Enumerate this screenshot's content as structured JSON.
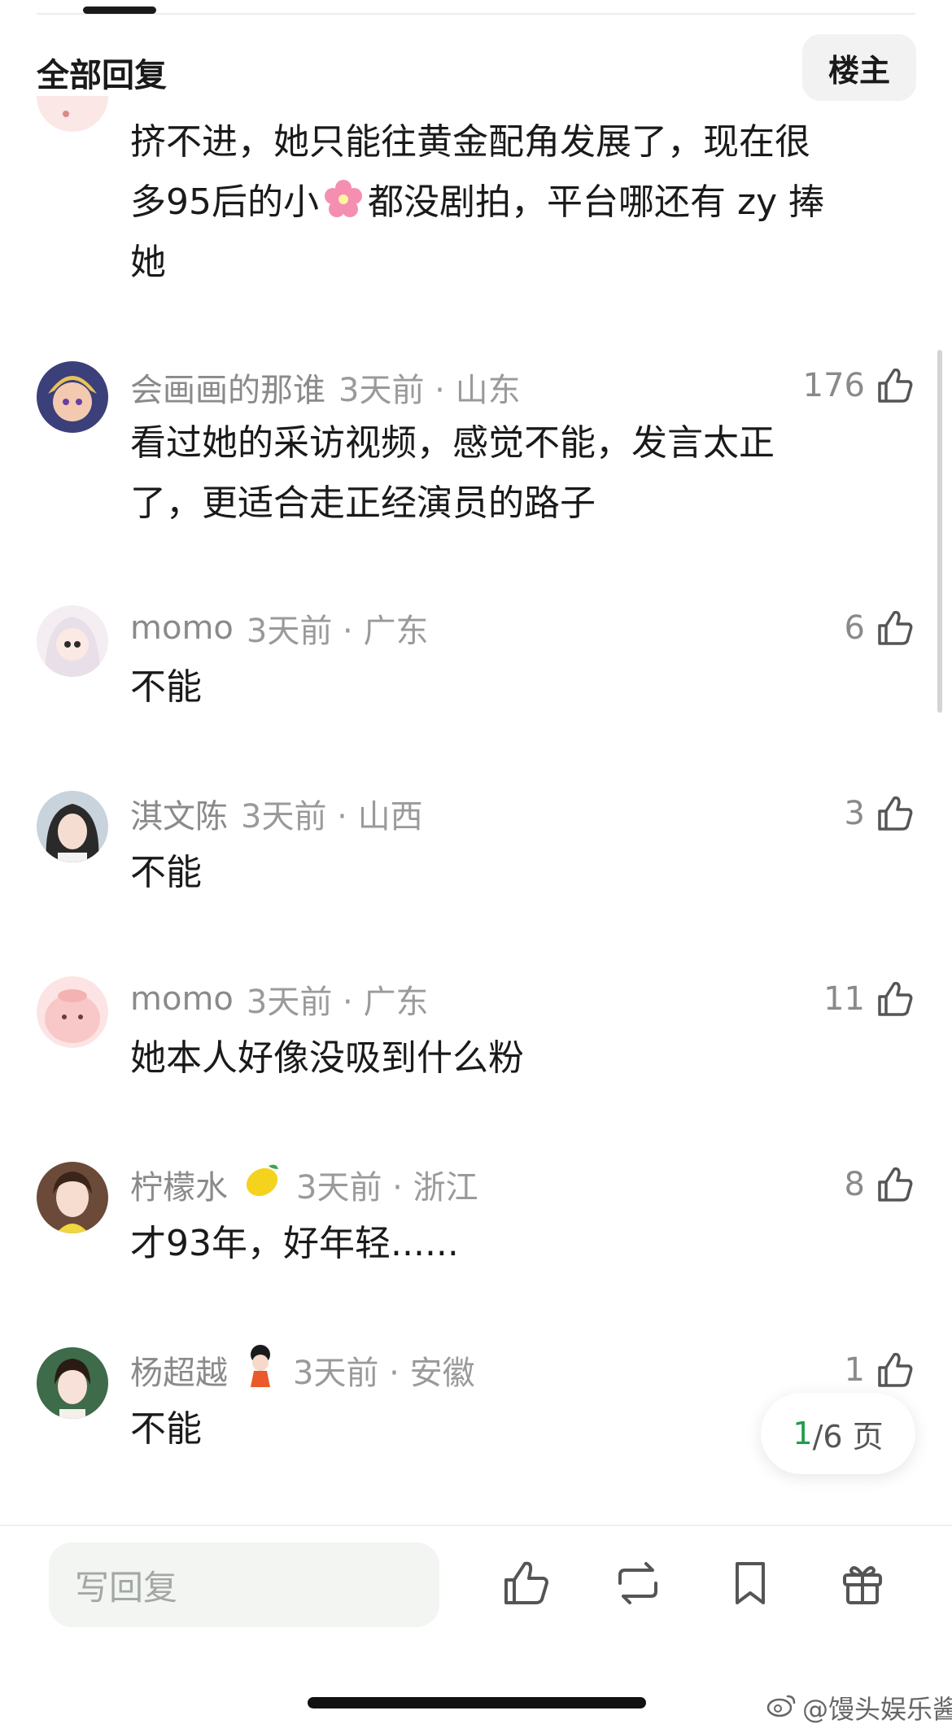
{
  "header": {
    "title": "全部回复",
    "louzhu_label": "楼主"
  },
  "continued_comment": {
    "line1": "挤不进，她只能往黄金配角发展了，现在很",
    "line2_before": "多95后的小",
    "line2_emoji": "cherry-blossom",
    "line2_after": "都没剧拍，平台哪还有 zy 捧",
    "line3": "她"
  },
  "comments": [
    {
      "username": "会画画的那谁",
      "time_location": "3天前 · 山东",
      "likes": "176",
      "text_line1": "看过她的采访视频，感觉不能，发言太正",
      "text_line2": "了，更适合走正经演员的路子"
    },
    {
      "username": "momo",
      "time_location": "3天前 · 广东",
      "likes": "6",
      "text_line1": "不能"
    },
    {
      "username": "淇文陈",
      "time_location": "3天前 · 山西",
      "likes": "3",
      "text_line1": "不能"
    },
    {
      "username": "momo",
      "time_location": "3天前 · 广东",
      "likes": "11",
      "text_line1": "她本人好像没吸到什么粉"
    },
    {
      "username": "柠檬水",
      "name_emoji": "lemon",
      "time_location": "3天前 · 浙江",
      "likes": "8",
      "text_line1": "才93年，好年轻......"
    },
    {
      "username": "杨超越",
      "name_emoji": "girl-sticker",
      "time_location": "3天前 · 安徽",
      "likes": "1",
      "text_line1": "不能"
    }
  ],
  "pager": {
    "current": "1",
    "total": "/6 页"
  },
  "bottom_bar": {
    "reply_placeholder": "写回复",
    "icons": [
      "like-icon",
      "repost-icon",
      "bookmark-icon",
      "gift-icon"
    ]
  },
  "watermark": "@馒头娱乐酱",
  "colors": {
    "accent_green": "#1e9e4a",
    "muted_text": "#9a9a9a"
  }
}
